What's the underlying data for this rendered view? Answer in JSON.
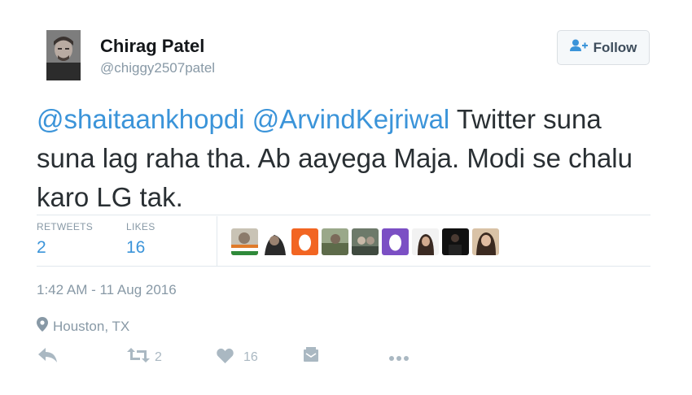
{
  "author": {
    "name": "Chirag Patel",
    "handle": "@chiggy2507patel",
    "avatar_icon": "user-avatar"
  },
  "follow_button": {
    "label": "Follow",
    "icon": "add-user-icon"
  },
  "tweet": {
    "mention_1": "@shaitaankhopdi",
    "mention_2": "@ArvindKejriwal",
    "body": " Twitter suna suna lag raha tha. Ab aayega Maja. Modi se chalu karo LG tak."
  },
  "stats": {
    "retweets_label": "RETWEETS",
    "retweets_value": "2",
    "likes_label": "LIKES",
    "likes_value": "16"
  },
  "likers": [
    "liker-1",
    "liker-2",
    "liker-3",
    "liker-4",
    "liker-5",
    "liker-6",
    "liker-7",
    "liker-8",
    "liker-9"
  ],
  "timestamp": "1:42 AM - 11 Aug 2016",
  "location": "Houston, TX",
  "actions": {
    "reply_icon": "reply-icon",
    "retweet_icon": "retweet-icon",
    "retweet_count": "2",
    "like_icon": "heart-icon",
    "like_count": "16",
    "dm_icon": "direct-message-icon",
    "more_icon": "more-icon"
  },
  "colors": {
    "link": "#3b94d9",
    "muted": "#8899a6",
    "text": "#292f33",
    "action_icon": "#aab8c2",
    "egg_orange": "#f26522",
    "egg_purple": "#7b4fc4"
  }
}
